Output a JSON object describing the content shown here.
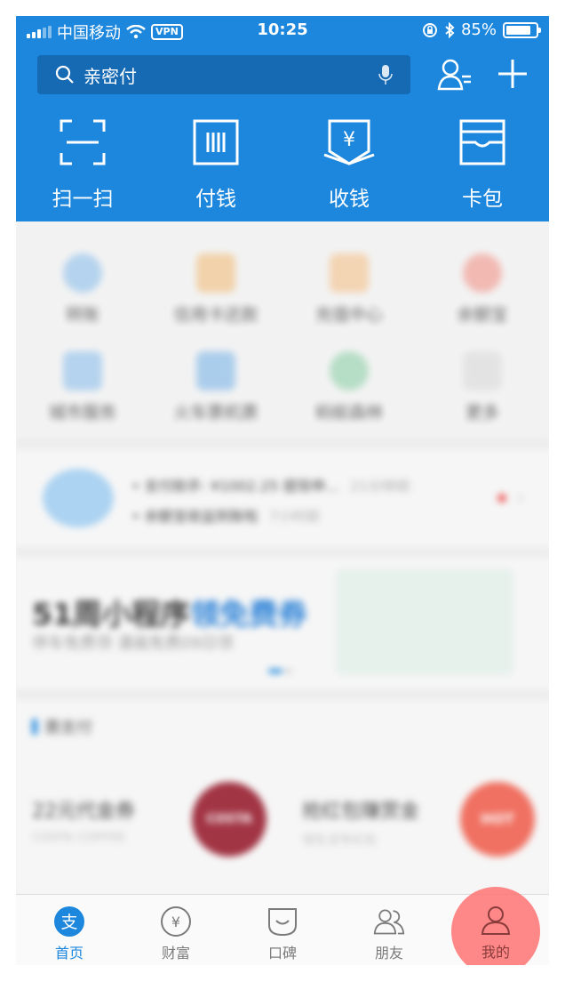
{
  "status": {
    "carrier": "中国移动",
    "vpn": "VPN",
    "time": "10:25",
    "battery": "85%",
    "battery_level": 0.85
  },
  "search": {
    "placeholder": "亲密付"
  },
  "quick_actions": [
    {
      "label": "扫一扫",
      "icon": "scan-icon"
    },
    {
      "label": "付钱",
      "icon": "barcode-icon"
    },
    {
      "label": "收钱",
      "icon": "receive-money-icon"
    },
    {
      "label": "卡包",
      "icon": "card-wallet-icon"
    }
  ],
  "services": [
    {
      "label": "转账",
      "icon": "transfer-icon"
    },
    {
      "label": "信用卡还款",
      "icon": "credit-card-icon"
    },
    {
      "label": "充值中心",
      "icon": "phone-topup-icon"
    },
    {
      "label": "余额宝",
      "icon": "yuebao-icon"
    },
    {
      "label": "城市服务",
      "icon": "city-service-icon"
    },
    {
      "label": "火车票机票",
      "icon": "ticket-icon"
    },
    {
      "label": "蚂蚁森林",
      "icon": "ant-forest-icon"
    },
    {
      "label": "更多",
      "icon": "more-grid-icon"
    }
  ],
  "news": [
    {
      "text": "支付助手: ¥1002.25 提现申...",
      "time": "21分钟前"
    },
    {
      "text": "余额宝收益到账啦",
      "time": "7小时前"
    }
  ],
  "promo": {
    "title_main": "51周小程序",
    "title_highlight": "领免费券",
    "subtitle": "停车免费领 漫画免费09日领"
  },
  "section": {
    "title": "惠支付"
  },
  "coupons": [
    {
      "title": "22元代金券",
      "sub": "COSTA COFFEE",
      "badge": "COSTA"
    },
    {
      "title": "抢红包赚赏金",
      "sub": "领生活专红包",
      "badge": "HOT"
    }
  ],
  "tabs": [
    {
      "label": "首页",
      "icon": "alipay-home-icon"
    },
    {
      "label": "财富",
      "icon": "wealth-yuan-icon"
    },
    {
      "label": "口碑",
      "icon": "koubei-icon"
    },
    {
      "label": "朋友",
      "icon": "friends-icon"
    },
    {
      "label": "我的",
      "icon": "my-profile-icon"
    }
  ],
  "colors": {
    "brand_blue": "#1c87dd",
    "highlight": "#ff6e6e"
  }
}
